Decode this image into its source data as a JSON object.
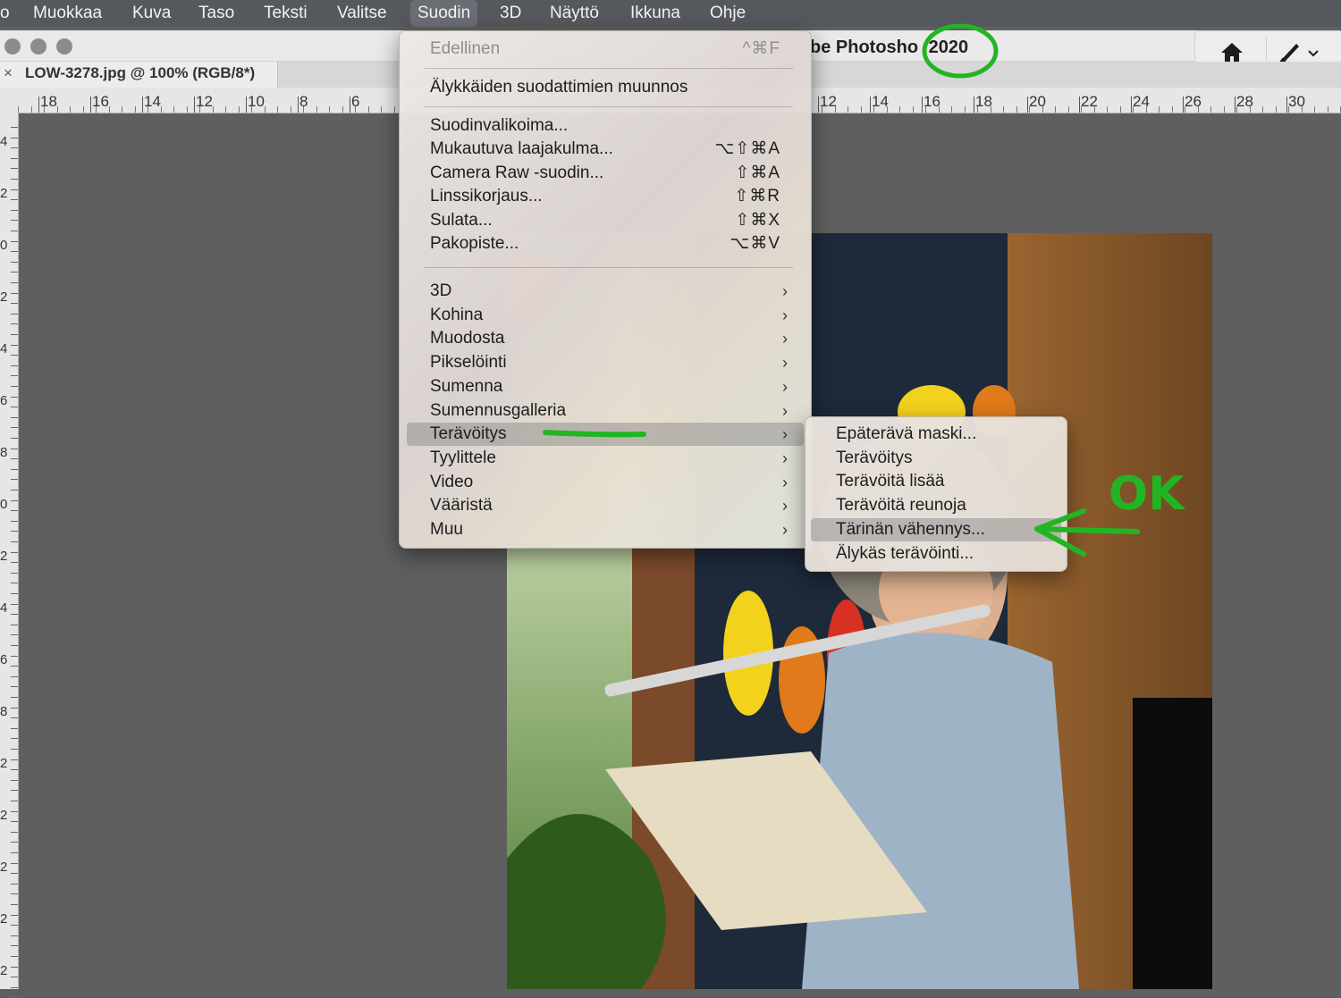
{
  "menubar": {
    "items": [
      "Muokkaa",
      "Kuva",
      "Taso",
      "Teksti",
      "Valitse",
      "Suodin",
      "3D",
      "Näyttö",
      "Ikkuna",
      "Ohje"
    ],
    "partial_left": "o"
  },
  "window": {
    "title": "be Photosho",
    "title_version": "2020",
    "doc_tab": "LOW-3278.jpg @ 100% (RGB/8*)",
    "tab_close": "×"
  },
  "ruler": {
    "left_labels": [
      "18",
      "16",
      "14",
      "12",
      "10",
      "8",
      "6"
    ],
    "right_labels": [
      "12",
      "14",
      "16",
      "18",
      "20",
      "22",
      "24",
      "26",
      "28",
      "30"
    ],
    "side_labels": [
      "4",
      "2",
      "0",
      "2",
      "4",
      "6",
      "8",
      "0",
      "2",
      "4",
      "6",
      "8",
      "2",
      "2",
      "2",
      "2",
      "2"
    ]
  },
  "filter_menu": {
    "last": {
      "label": "Edellinen",
      "shortcut": "^⌘F"
    },
    "smart": "Älykkäiden suodattimien muunnos",
    "group1": [
      {
        "label": "Suodinvalikoima...",
        "shortcut": ""
      },
      {
        "label": "Mukautuva laajakulma...",
        "shortcut": "⌥⇧⌘A"
      },
      {
        "label": "Camera Raw -suodin...",
        "shortcut": "⇧⌘A"
      },
      {
        "label": "Linssikorjaus...",
        "shortcut": "⇧⌘R"
      },
      {
        "label": "Sulata...",
        "shortcut": "⇧⌘X"
      },
      {
        "label": "Pakopiste...",
        "shortcut": "⌥⌘V"
      }
    ],
    "group2": [
      "3D",
      "Kohina",
      "Muodosta",
      "Pikselöinti",
      "Sumenna",
      "Sumennusgalleria",
      "Terävöitys",
      "Tyylittele",
      "Video",
      "Vääristä",
      "Muu"
    ],
    "arrow": "›"
  },
  "sharpen_submenu": {
    "items": [
      "Epäterävä maski...",
      "Terävöitys",
      "Terävöitä lisää",
      "Terävöitä reunoja",
      "Tärinän vähennys...",
      "Älykäs terävöinti..."
    ]
  },
  "annotation": {
    "ok_text": "OK",
    "color": "#22b523"
  }
}
